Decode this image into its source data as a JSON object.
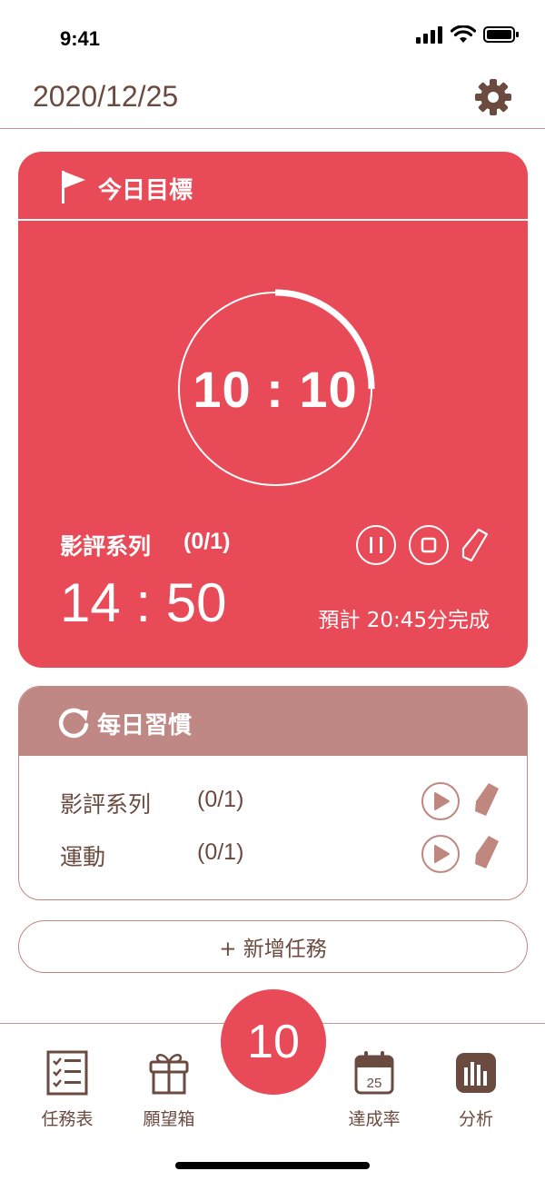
{
  "status_bar": {
    "time": "9:41"
  },
  "header": {
    "date": "2020/12/25"
  },
  "goal_card": {
    "title": "今日目標",
    "timer": "10 : 10",
    "timer_progress": 0.25,
    "task_name": "影評系列",
    "task_count": "(0/1)",
    "remaining": "14 : 50",
    "eta": "預計 20:45分完成"
  },
  "habit_card": {
    "title": "每日習慣",
    "items": [
      {
        "name": "影評系列",
        "count": "(0/1)"
      },
      {
        "name": "運動",
        "count": "(0/1)"
      }
    ]
  },
  "add_task": {
    "label": "+ 新增任務"
  },
  "bottom_nav": {
    "items": [
      {
        "label": "任務表",
        "icon": "checklist-icon"
      },
      {
        "label": "願望箱",
        "icon": "gift-icon"
      },
      {
        "label": "達成率",
        "icon": "calendar-icon"
      },
      {
        "label": "分析",
        "icon": "bar-chart-icon"
      }
    ],
    "center_value": "10",
    "calendar_day": "25"
  },
  "colors": {
    "primary": "#e84b57",
    "habit_header": "#bf8885",
    "text": "#6b4a40",
    "border": "#c0877f"
  }
}
